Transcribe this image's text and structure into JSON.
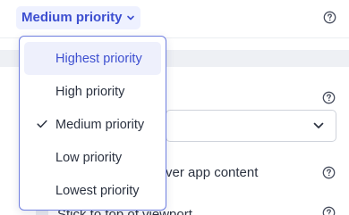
{
  "priority": {
    "current_label": "Medium priority",
    "options": [
      {
        "label": "Highest priority",
        "highlighted": true,
        "selected": false
      },
      {
        "label": "High priority",
        "highlighted": false,
        "selected": false
      },
      {
        "label": "Medium priority",
        "highlighted": false,
        "selected": true
      },
      {
        "label": "Low priority",
        "highlighted": false,
        "selected": false
      },
      {
        "label": "Lowest priority",
        "highlighted": false,
        "selected": false
      }
    ]
  },
  "background": {
    "option_1_text": "ver app content",
    "option_2_text": "Stick to top of viewport"
  },
  "colors": {
    "accent": "#3d4fd0",
    "accent_bg": "#eef1ff",
    "menu_border": "#6f7ee0"
  }
}
